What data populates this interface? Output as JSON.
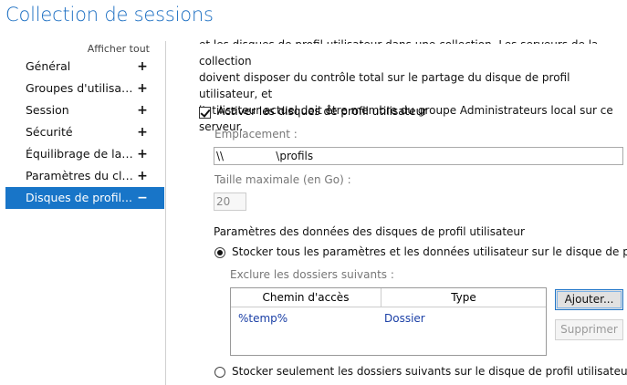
{
  "page_title": "Collection de sessions",
  "nav": {
    "show_all": "Afficher tout",
    "items": [
      {
        "label": "Général",
        "symbol": "+"
      },
      {
        "label": "Groupes d'utilisate...",
        "symbol": "+"
      },
      {
        "label": "Session",
        "symbol": "+"
      },
      {
        "label": "Sécurité",
        "symbol": "+"
      },
      {
        "label": "Équilibrage de la c...",
        "symbol": "+"
      },
      {
        "label": "Paramètres du client",
        "symbol": "+"
      },
      {
        "label": "Disques de profil...",
        "symbol": "−",
        "selected": true
      }
    ]
  },
  "main": {
    "description_line1": "et les disques de profil utilisateur dans une collection. Les serveurs de la collection",
    "description_line2": "doivent disposer du contrôle total sur le partage du disque de profil utilisateur, et",
    "description_line3": "l'utilisateur actuel doit être membre du groupe Administrateurs local sur ce serveur.",
    "enable_checkbox_label": "Activer les disques de profil utilisateur",
    "enable_checked": true,
    "location_label": "Emplacement :",
    "location_value": "\\\\               \\profils",
    "max_size_label": "Taille maximale (en Go) :",
    "max_size_value": "20",
    "settings_section_label": "Paramètres des données des disques de profil utilisateur",
    "radio_store_all_label": "Stocker tous les paramètres et les données utilisateur sur le disque de profil utilisateur",
    "radio_store_all_selected": true,
    "exclude_label": "Exclure les dossiers suivants :",
    "table": {
      "columns": [
        "Chemin d'accès",
        "Type"
      ],
      "rows": [
        {
          "path": "%temp%",
          "type": "Dossier"
        }
      ]
    },
    "add_button": "Ajouter...",
    "remove_button": "Supprimer",
    "radio_store_only_label": "Stocker seulement les dossiers suivants sur le disque de profil utilisateur",
    "radio_store_only_selected": false
  },
  "colors": {
    "accent": "#1875c8",
    "title": "#1b6ec2",
    "link_text": "#1a3fa6"
  }
}
